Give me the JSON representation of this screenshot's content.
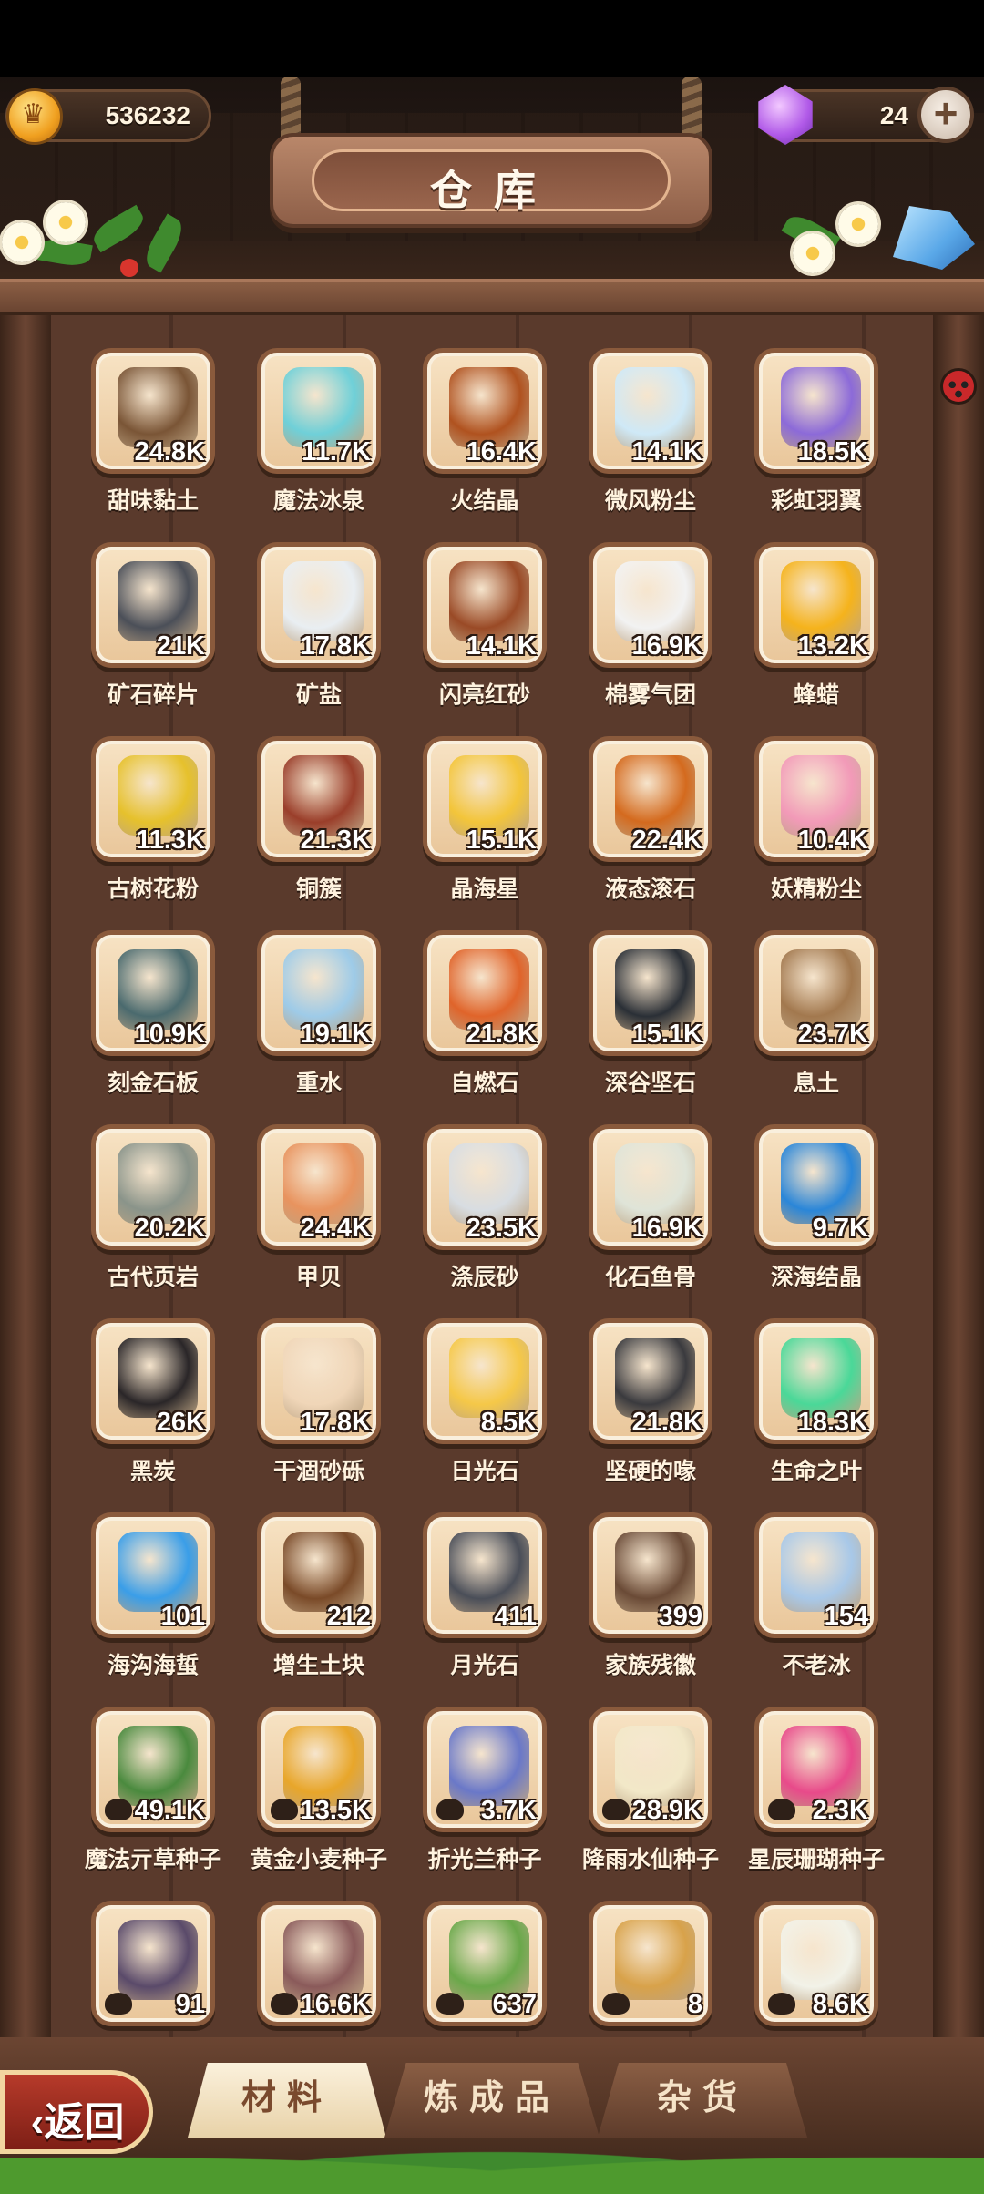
{
  "resources": {
    "coins": "536232",
    "gems": "24"
  },
  "title": "仓库",
  "items": [
    {
      "name": "甜味黏土",
      "count": "24.8K",
      "color": "#7a5536"
    },
    {
      "name": "魔法冰泉",
      "count": "11.7K",
      "color": "#6fd0d8"
    },
    {
      "name": "火结晶",
      "count": "16.4K",
      "color": "#b0521f"
    },
    {
      "name": "微风粉尘",
      "count": "14.1K",
      "color": "#cfe9f7"
    },
    {
      "name": "彩虹羽翼",
      "count": "18.5K",
      "color": "#8c6ad8"
    },
    {
      "name": "矿石碎片",
      "count": "21K",
      "color": "#4b4f58"
    },
    {
      "name": "矿盐",
      "count": "17.8K",
      "color": "#e9eef2"
    },
    {
      "name": "闪亮红砂",
      "count": "14.1K",
      "color": "#9a4a26"
    },
    {
      "name": "棉雾气团",
      "count": "16.9K",
      "color": "#f2f2f2"
    },
    {
      "name": "蜂蜡",
      "count": "13.2K",
      "color": "#f5b31c"
    },
    {
      "name": "古树花粉",
      "count": "11.3K",
      "color": "#e6c12c"
    },
    {
      "name": "铜簇",
      "count": "21.3K",
      "color": "#9a3e2a"
    },
    {
      "name": "晶海星",
      "count": "15.1K",
      "color": "#f3c53a"
    },
    {
      "name": "液态滚石",
      "count": "22.4K",
      "color": "#d46a1e"
    },
    {
      "name": "妖精粉尘",
      "count": "10.4K",
      "color": "#f29ab8"
    },
    {
      "name": "刻金石板",
      "count": "10.9K",
      "color": "#4a6a6e"
    },
    {
      "name": "重水",
      "count": "19.1K",
      "color": "#9ecbe8"
    },
    {
      "name": "自燃石",
      "count": "21.8K",
      "color": "#e0642a"
    },
    {
      "name": "深谷坚石",
      "count": "15.1K",
      "color": "#2a2f36"
    },
    {
      "name": "息土",
      "count": "23.7K",
      "color": "#a2784e"
    },
    {
      "name": "古代页岩",
      "count": "20.2K",
      "color": "#8a948a"
    },
    {
      "name": "甲贝",
      "count": "24.4K",
      "color": "#e8935e"
    },
    {
      "name": "涤辰砂",
      "count": "23.5K",
      "color": "#d8dde2"
    },
    {
      "name": "化石鱼骨",
      "count": "16.9K",
      "color": "#dfe4d8"
    },
    {
      "name": "深海结晶",
      "count": "9.7K",
      "color": "#2a86d8"
    },
    {
      "name": "黑炭",
      "count": "26K",
      "color": "#2a2628"
    },
    {
      "name": "干涸砂砾",
      "count": "17.8K",
      "color": "#f0d6b8"
    },
    {
      "name": "日光石",
      "count": "8.5K",
      "color": "#f5c848"
    },
    {
      "name": "坚硬的喙",
      "count": "21.8K",
      "color": "#3a3a3e"
    },
    {
      "name": "生命之叶",
      "count": "18.3K",
      "color": "#4ad898"
    },
    {
      "name": "海沟海蜇",
      "count": "101",
      "color": "#3a9ee8"
    },
    {
      "name": "增生土块",
      "count": "212",
      "color": "#7a4a28"
    },
    {
      "name": "月光石",
      "count": "411",
      "color": "#4a4e58"
    },
    {
      "name": "家族残徽",
      "count": "399",
      "color": "#6a4a36"
    },
    {
      "name": "不老冰",
      "count": "154",
      "color": "#a8c8e8"
    },
    {
      "name": "魔法亓草种子",
      "count": "49.1K",
      "color": "#4a8a3e",
      "seed": true
    },
    {
      "name": "黄金小麦种子",
      "count": "13.5K",
      "color": "#e8a62a",
      "seed": true
    },
    {
      "name": "折光兰种子",
      "count": "3.7K",
      "color": "#6a78c8",
      "seed": true
    },
    {
      "name": "降雨水仙种子",
      "count": "28.9K",
      "color": "#f2e8c8",
      "seed": true
    },
    {
      "name": "星辰珊瑚种子",
      "count": "2.3K",
      "color": "#e84a8a",
      "seed": true
    },
    {
      "name": "",
      "count": "91",
      "color": "#5a4a6a",
      "seed": true
    },
    {
      "name": "",
      "count": "16.6K",
      "color": "#8a5a5a",
      "seed": true
    },
    {
      "name": "",
      "count": "637",
      "color": "#6aa84a",
      "seed": true
    },
    {
      "name": "",
      "count": "8",
      "color": "#d8a24a",
      "seed": true
    },
    {
      "name": "",
      "count": "8.6K",
      "color": "#f2f2e8",
      "seed": true
    }
  ],
  "tabs": [
    "材料",
    "炼成品",
    "杂货"
  ],
  "back_label": "返回"
}
